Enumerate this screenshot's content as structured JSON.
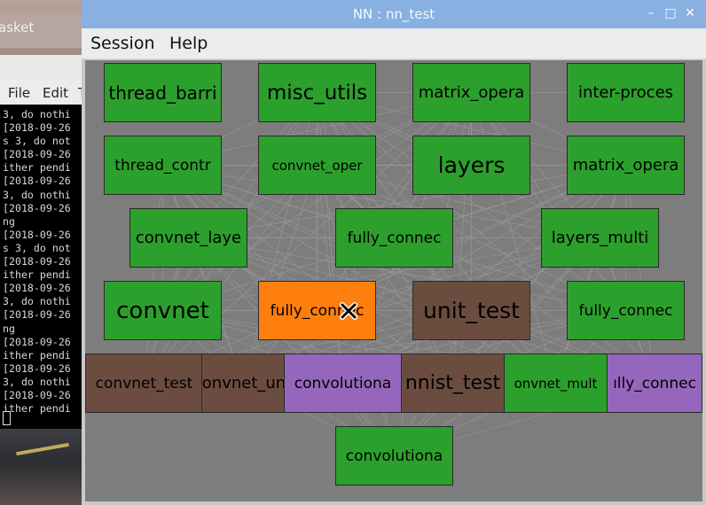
{
  "background": {
    "title_fragment": "asket",
    "menu": [
      "File",
      "Edit",
      "T"
    ],
    "terminal_lines": [
      "3, do nothi",
      "[2018-09-26",
      "s 3, do not",
      "[2018-09-26",
      "ither pendi",
      "[2018-09-26",
      "3, do nothi",
      "[2018-09-26",
      "ng",
      "[2018-09-26",
      "s 3, do not",
      "[2018-09-26",
      "ither pendi",
      "[2018-09-26",
      "3, do nothi",
      "[2018-09-26",
      "ng",
      "[2018-09-26",
      "ither pendi",
      "[2018-09-26",
      "3, do nothi",
      "[2018-09-26",
      "ither pendi"
    ]
  },
  "window": {
    "title": "NN : nn_test",
    "controls": {
      "minimize": "–",
      "maximize": "□",
      "close": "✕"
    }
  },
  "menu": {
    "session": "Session",
    "help": "Help"
  },
  "graph": {
    "colors": {
      "green": "#2ca02c",
      "orange": "#ff7f0e",
      "brown": "#6b4d3f",
      "purple": "#9467bd",
      "edge": "#9a9a9a"
    },
    "nodes": [
      {
        "label": "thread_barri",
        "color": "green"
      },
      {
        "label": "misc_utils",
        "color": "green"
      },
      {
        "label": "matrix_opera",
        "color": "green"
      },
      {
        "label": "inter-proces",
        "color": "green"
      },
      {
        "label": "thread_contr",
        "color": "green"
      },
      {
        "label": "convnet_oper",
        "color": "green"
      },
      {
        "label": "layers",
        "color": "green"
      },
      {
        "label": "matrix_opera",
        "color": "green"
      },
      {
        "label": "convnet_laye",
        "color": "green"
      },
      {
        "label": "fully_connec",
        "color": "green"
      },
      {
        "label": "layers_multi",
        "color": "green"
      },
      {
        "label": "convnet",
        "color": "green"
      },
      {
        "label": "fully_connec",
        "color": "orange"
      },
      {
        "label": "unit_test",
        "color": "brown"
      },
      {
        "label": "fully_connec",
        "color": "green"
      },
      {
        "label": "convnet_test",
        "color": "brown"
      },
      {
        "label": "onvnet_un",
        "color": "brown"
      },
      {
        "label": "convolutiona",
        "color": "purple"
      },
      {
        "label": "nnist_test",
        "color": "brown"
      },
      {
        "label": "onvnet_mult",
        "color": "green"
      },
      {
        "label": "ılly_connec",
        "color": "purple"
      },
      {
        "label": "convolutiona",
        "color": "green"
      }
    ]
  }
}
